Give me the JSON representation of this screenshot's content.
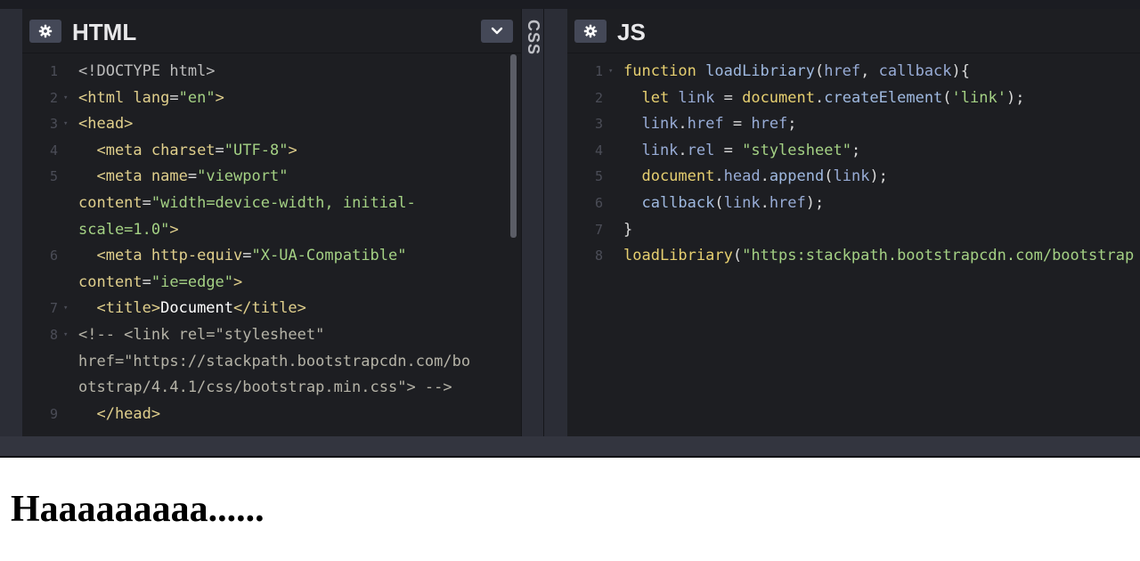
{
  "html_panel": {
    "title": "HTML",
    "lines": [
      {
        "num": "1",
        "fold": "",
        "segments": [
          [
            "t-doc",
            "<!DOCTYPE html>"
          ]
        ]
      },
      {
        "num": "2",
        "fold": "▾",
        "segments": [
          [
            "t-tag",
            "<html "
          ],
          [
            "t-attr",
            "lang"
          ],
          [
            "t-plain",
            "="
          ],
          [
            "t-val",
            "\"en\""
          ],
          [
            "t-tag",
            ">"
          ]
        ]
      },
      {
        "num": "3",
        "fold": "▾",
        "segments": [
          [
            "t-tag",
            "<head>"
          ]
        ]
      },
      {
        "num": "4",
        "fold": "",
        "segments": [
          [
            "t-tag",
            "  <meta "
          ],
          [
            "t-attr",
            "charset"
          ],
          [
            "t-plain",
            "="
          ],
          [
            "t-val",
            "\"UTF-8\""
          ],
          [
            "t-tag",
            ">"
          ]
        ]
      },
      {
        "num": "5",
        "fold": "",
        "segments": [
          [
            "t-tag",
            "  <meta "
          ],
          [
            "t-attr",
            "name"
          ],
          [
            "t-plain",
            "="
          ],
          [
            "t-val",
            "\"viewport\""
          ]
        ]
      },
      {
        "num": "",
        "fold": "",
        "segments": [
          [
            "t-attr",
            "content"
          ],
          [
            "t-plain",
            "="
          ],
          [
            "t-val",
            "\"width=device-width, initial-"
          ]
        ]
      },
      {
        "num": "",
        "fold": "",
        "segments": [
          [
            "t-val",
            "scale=1.0\""
          ],
          [
            "t-tag",
            ">"
          ]
        ]
      },
      {
        "num": "6",
        "fold": "",
        "segments": [
          [
            "t-tag",
            "  <meta "
          ],
          [
            "t-attr",
            "http-equiv"
          ],
          [
            "t-plain",
            "="
          ],
          [
            "t-val",
            "\"X-UA-Compatible\""
          ]
        ]
      },
      {
        "num": "",
        "fold": "",
        "segments": [
          [
            "t-attr",
            "content"
          ],
          [
            "t-plain",
            "="
          ],
          [
            "t-val",
            "\"ie=edge\""
          ],
          [
            "t-tag",
            ">"
          ]
        ]
      },
      {
        "num": "7",
        "fold": "▾",
        "segments": [
          [
            "t-tag",
            "  <title>"
          ],
          [
            "t-text",
            "Document"
          ],
          [
            "t-tag",
            "</title>"
          ]
        ]
      },
      {
        "num": "8",
        "fold": "▾",
        "segments": [
          [
            "t-cmt",
            "<!-- <link rel=\"stylesheet\""
          ]
        ]
      },
      {
        "num": "",
        "fold": "",
        "segments": [
          [
            "t-cmt",
            "href=\"https://stackpath.bootstrapcdn.com/bo"
          ]
        ]
      },
      {
        "num": "",
        "fold": "",
        "segments": [
          [
            "t-cmt",
            "otstrap/4.4.1/css/bootstrap.min.css\"> -->"
          ]
        ]
      },
      {
        "num": "9",
        "fold": "",
        "segments": [
          [
            "t-tag",
            "  </head>"
          ]
        ]
      }
    ]
  },
  "css_panel": {
    "title": "CSS"
  },
  "js_panel": {
    "title": "JS",
    "lines": [
      {
        "num": "1",
        "fold": "▾",
        "segments": [
          [
            "t-kw",
            "function "
          ],
          [
            "t-fn",
            "loadLibriary"
          ],
          [
            "t-plain",
            "("
          ],
          [
            "t-var",
            "href"
          ],
          [
            "t-plain",
            ", "
          ],
          [
            "t-var",
            "callback"
          ],
          [
            "t-plain",
            "){"
          ]
        ]
      },
      {
        "num": "2",
        "fold": "",
        "segments": [
          [
            "t-kw",
            "  let "
          ],
          [
            "t-var",
            "link"
          ],
          [
            "t-plain",
            " = "
          ],
          [
            "t-kw",
            "document"
          ],
          [
            "t-plain",
            "."
          ],
          [
            "t-fn",
            "createElement"
          ],
          [
            "t-plain",
            "("
          ],
          [
            "t-str",
            "'link'"
          ],
          [
            "t-plain",
            ");"
          ]
        ]
      },
      {
        "num": "3",
        "fold": "",
        "segments": [
          [
            "t-var",
            "  link"
          ],
          [
            "t-plain",
            "."
          ],
          [
            "t-var",
            "href"
          ],
          [
            "t-plain",
            " = "
          ],
          [
            "t-var",
            "href"
          ],
          [
            "t-plain",
            ";"
          ]
        ]
      },
      {
        "num": "4",
        "fold": "",
        "segments": [
          [
            "t-var",
            "  link"
          ],
          [
            "t-plain",
            "."
          ],
          [
            "t-var",
            "rel"
          ],
          [
            "t-plain",
            " = "
          ],
          [
            "t-str",
            "\"stylesheet\""
          ],
          [
            "t-plain",
            ";"
          ]
        ]
      },
      {
        "num": "5",
        "fold": "",
        "segments": [
          [
            "t-kw",
            "  document"
          ],
          [
            "t-plain",
            "."
          ],
          [
            "t-var",
            "head"
          ],
          [
            "t-plain",
            "."
          ],
          [
            "t-fn",
            "append"
          ],
          [
            "t-plain",
            "("
          ],
          [
            "t-var",
            "link"
          ],
          [
            "t-plain",
            ");"
          ]
        ]
      },
      {
        "num": "6",
        "fold": "",
        "segments": [
          [
            "t-fn",
            "  callback"
          ],
          [
            "t-plain",
            "("
          ],
          [
            "t-var",
            "link"
          ],
          [
            "t-plain",
            "."
          ],
          [
            "t-var",
            "href"
          ],
          [
            "t-plain",
            ");"
          ]
        ]
      },
      {
        "num": "7",
        "fold": "",
        "segments": [
          [
            "t-plain",
            "}"
          ]
        ]
      },
      {
        "num": "8",
        "fold": "",
        "segments": [
          [
            "t-kw",
            "loadLibriary"
          ],
          [
            "t-plain",
            "("
          ],
          [
            "t-str",
            "\"https:stackpath.bootstrapcdn.com/bootstrap"
          ]
        ]
      }
    ]
  },
  "preview": {
    "heading": "Haaaaaaaaa......"
  },
  "icons": {
    "settings": "gear-icon",
    "collapse": "chevron-down-icon"
  }
}
